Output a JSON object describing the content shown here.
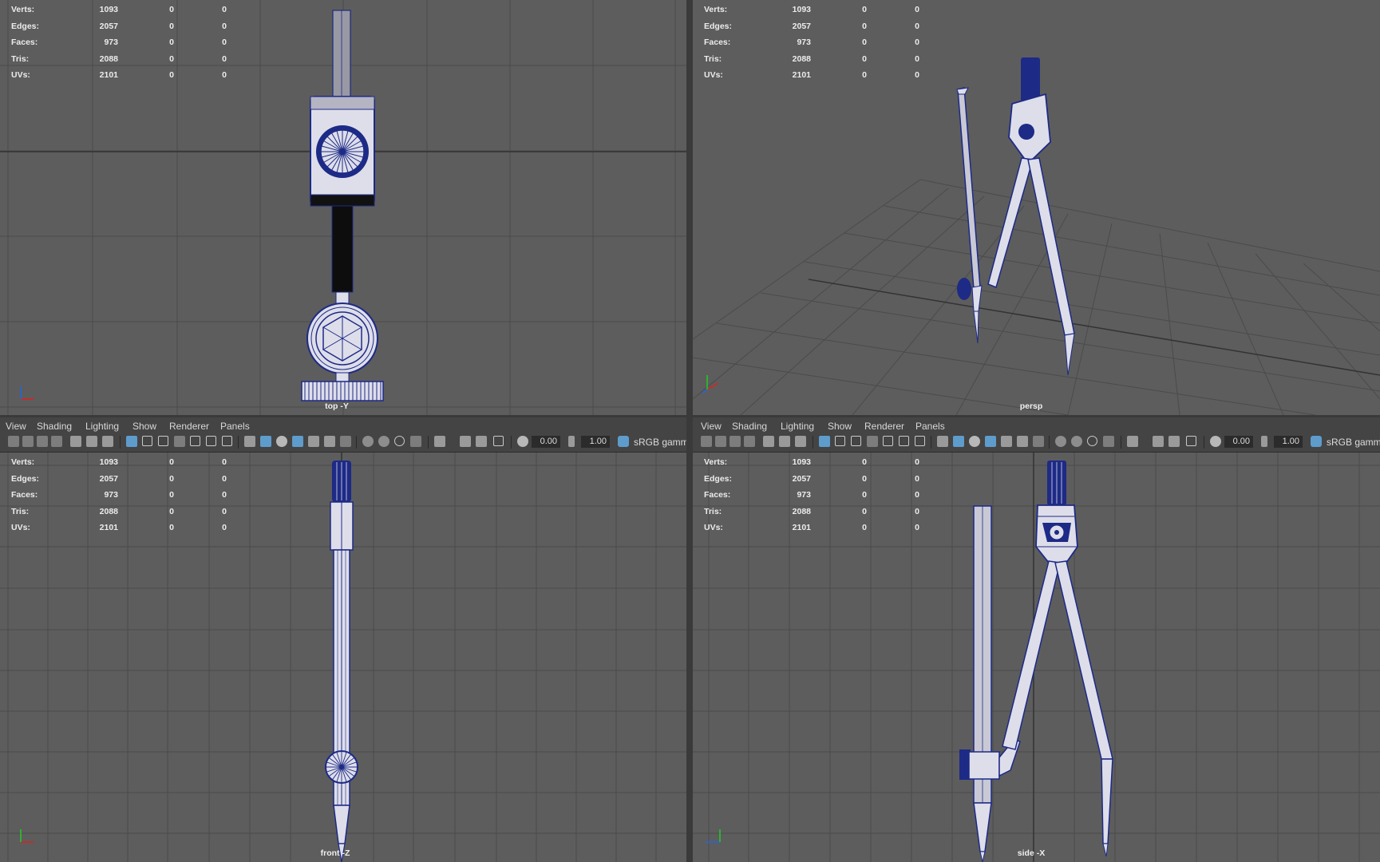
{
  "stats": {
    "rows": [
      {
        "label": "Verts:",
        "v1": "1093",
        "v2": "0",
        "v3": "0"
      },
      {
        "label": "Edges:",
        "v1": "2057",
        "v2": "0",
        "v3": "0"
      },
      {
        "label": "Faces:",
        "v1": "973",
        "v2": "0",
        "v3": "0"
      },
      {
        "label": "Tris:",
        "v1": "2088",
        "v2": "0",
        "v3": "0"
      },
      {
        "label": "UVs:",
        "v1": "2101",
        "v2": "0",
        "v3": "0"
      }
    ]
  },
  "menu": {
    "view": "View",
    "shading": "Shading",
    "lighting": "Lighting",
    "show": "Show",
    "renderer": "Renderer",
    "panels": "Panels"
  },
  "toolbar": {
    "exposure": "0.00",
    "gamma": "1.00",
    "color_space": "sRGB gamm"
  },
  "cameras": {
    "top": "top -Y",
    "persp": "persp",
    "front": "front -Z",
    "side": "side -X"
  },
  "colors": {
    "viewport_bg": "#5d5d5d",
    "grid": "#4a4a4a",
    "grid_axis": "#2e2e2e",
    "wire": "#1d2a86",
    "surface": "#dedeea",
    "menubar": "#444444"
  }
}
